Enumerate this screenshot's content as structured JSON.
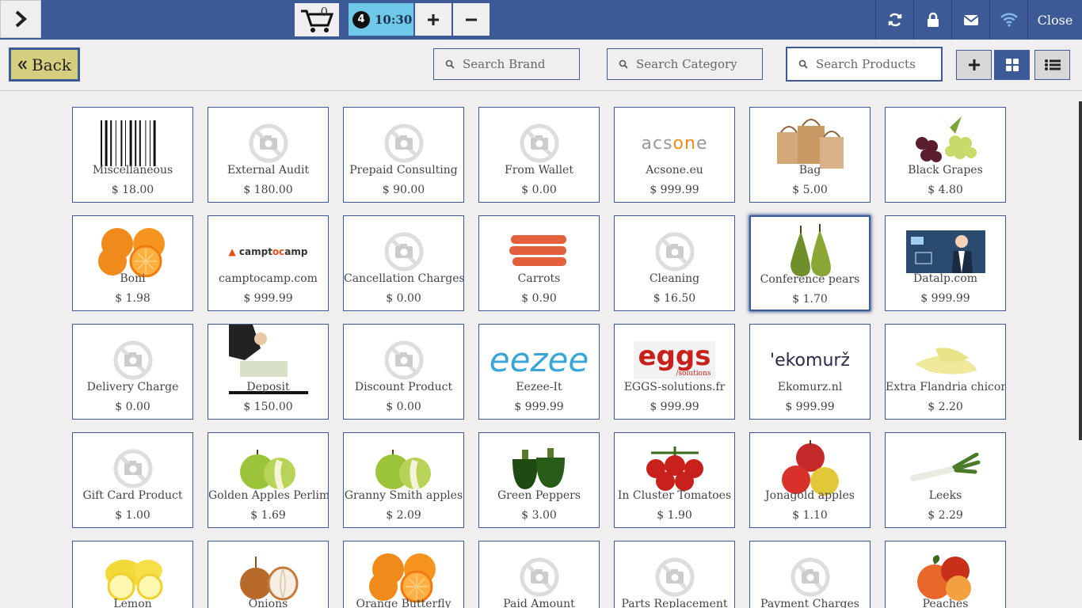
{
  "topbar": {
    "cart_count": "0",
    "order_number": "4",
    "order_time": "10:30",
    "close_label": "Close"
  },
  "subbar": {
    "back_label": "Back",
    "search_brand_placeholder": "Search Brand",
    "search_category_placeholder": "Search Category",
    "search_products_placeholder": "Search Products"
  },
  "products": [
    {
      "name": "Miscellaneous",
      "price": "$ 18.00",
      "icon": "barcode"
    },
    {
      "name": "External Audit",
      "price": "$ 180.00",
      "icon": "no-image"
    },
    {
      "name": "Prepaid Consulting",
      "price": "$ 90.00",
      "icon": "no-image"
    },
    {
      "name": "From Wallet",
      "price": "$ 0.00",
      "icon": "no-image"
    },
    {
      "name": "Acsone.eu",
      "price": "$ 999.99",
      "icon": "acsone-logo",
      "logo_text": "acsone"
    },
    {
      "name": "Bag",
      "price": "$ 5.00",
      "icon": "bag"
    },
    {
      "name": "Black Grapes",
      "price": "$ 4.80",
      "icon": "grapes"
    },
    {
      "name": "Boni",
      "price": "$ 1.98",
      "icon": "orange"
    },
    {
      "name": "camptocamp.com",
      "price": "$ 999.99",
      "icon": "camptocamp-logo",
      "logo_text": "camptocamp"
    },
    {
      "name": "Cancellation Charges",
      "price": "$ 0.00",
      "icon": "no-image"
    },
    {
      "name": "Carrots",
      "price": "$ 0.90",
      "icon": "carrot"
    },
    {
      "name": "Cleaning",
      "price": "$ 16.50",
      "icon": "no-image"
    },
    {
      "name": "Conference pears",
      "price": "$ 1.70",
      "icon": "pear"
    },
    {
      "name": "Datalp.com",
      "price": "$ 999.99",
      "icon": "datalp-image"
    },
    {
      "name": "Delivery Charge",
      "price": "$ 0.00",
      "icon": "no-image"
    },
    {
      "name": "Deposit",
      "price": "$ 150.00",
      "icon": "deposit-image"
    },
    {
      "name": "Discount Product",
      "price": "$ 0.00",
      "icon": "no-image"
    },
    {
      "name": "Eezee-It",
      "price": "$ 999.99",
      "icon": "eezee-logo",
      "logo_text": "eezee"
    },
    {
      "name": "EGGS-solutions.fr",
      "price": "$ 999.99",
      "icon": "eggs-logo",
      "logo_text": "eggs",
      "logo_sub": "/solutions"
    },
    {
      "name": "Ekomurz.nl",
      "price": "$ 999.99",
      "icon": "ekomurz-logo",
      "logo_text": "'ekomurž"
    },
    {
      "name": "Extra Flandria chicory",
      "price": "$ 2.20",
      "icon": "chicory"
    },
    {
      "name": "Gift Card Product",
      "price": "$ 1.00",
      "icon": "no-image"
    },
    {
      "name": "Golden Apples Perlim",
      "price": "$ 1.69",
      "icon": "green-apple"
    },
    {
      "name": "Granny Smith apples",
      "price": "$ 2.09",
      "icon": "green-apple"
    },
    {
      "name": "Green Peppers",
      "price": "$ 3.00",
      "icon": "pepper"
    },
    {
      "name": "In Cluster Tomatoes",
      "price": "$ 1.90",
      "icon": "tomato"
    },
    {
      "name": "Jonagold apples",
      "price": "$ 1.10",
      "icon": "red-apple"
    },
    {
      "name": "Leeks",
      "price": "$ 2.29",
      "icon": "leek"
    },
    {
      "name": "Lemon",
      "price": "",
      "icon": "lemon"
    },
    {
      "name": "Onions",
      "price": "",
      "icon": "onion"
    },
    {
      "name": "Orange Butterfly",
      "price": "",
      "icon": "orange"
    },
    {
      "name": "Paid Amount",
      "price": "",
      "icon": "no-image"
    },
    {
      "name": "Parts Replacement",
      "price": "",
      "icon": "no-image"
    },
    {
      "name": "Payment Charges",
      "price": "",
      "icon": "no-image"
    },
    {
      "name": "Peaches",
      "price": "",
      "icon": "peach"
    }
  ],
  "colors": {
    "brand": "#3c5a96",
    "order_tab": "#6ec8e8",
    "back_button": "#d5ce7e"
  }
}
